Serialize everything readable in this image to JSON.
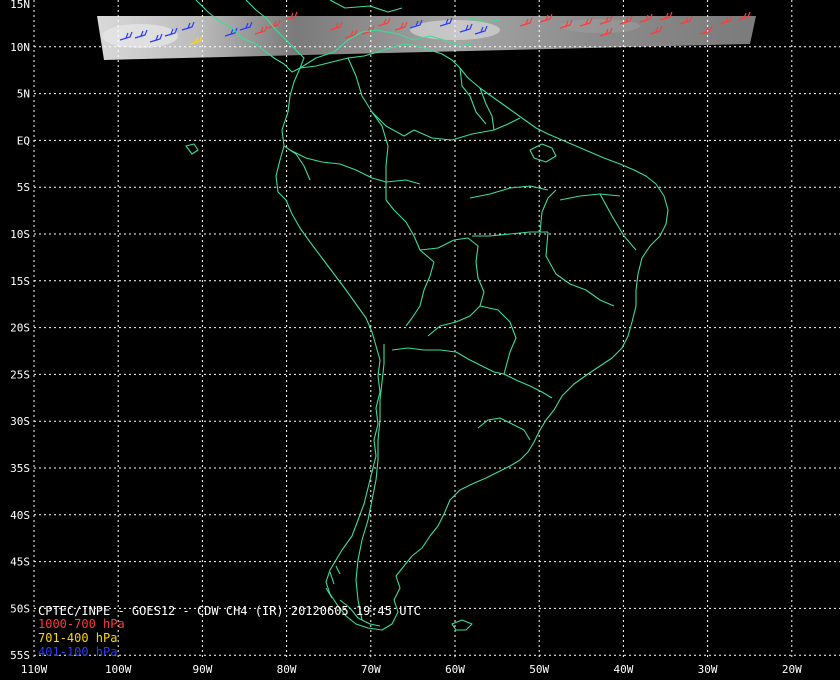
{
  "title": "CPTEC/INPE - GOES12 - CDW CH4 (IR) 20120605 19:45 UTC",
  "legend": [
    {
      "label": "1000-700 hPa",
      "color": "#ff3b3b"
    },
    {
      "label": "701-400 hPa",
      "color": "#ffd700"
    },
    {
      "label": "401-100 hPa",
      "color": "#2a3cff"
    }
  ],
  "latitude_labels": [
    "15N",
    "10N",
    "5N",
    "EQ",
    "5S",
    "10S",
    "15S",
    "20S",
    "25S",
    "30S",
    "35S",
    "40S",
    "45S",
    "50S",
    "55S"
  ],
  "longitude_labels": [
    "110W",
    "100W",
    "90W",
    "80W",
    "70W",
    "60W",
    "50W",
    "40W",
    "30W",
    "20W"
  ],
  "colors": {
    "background": "#000000",
    "coastline": "#3ddc97",
    "grid": "#ffffff",
    "satellite_strip": "#8a8a8a"
  }
}
